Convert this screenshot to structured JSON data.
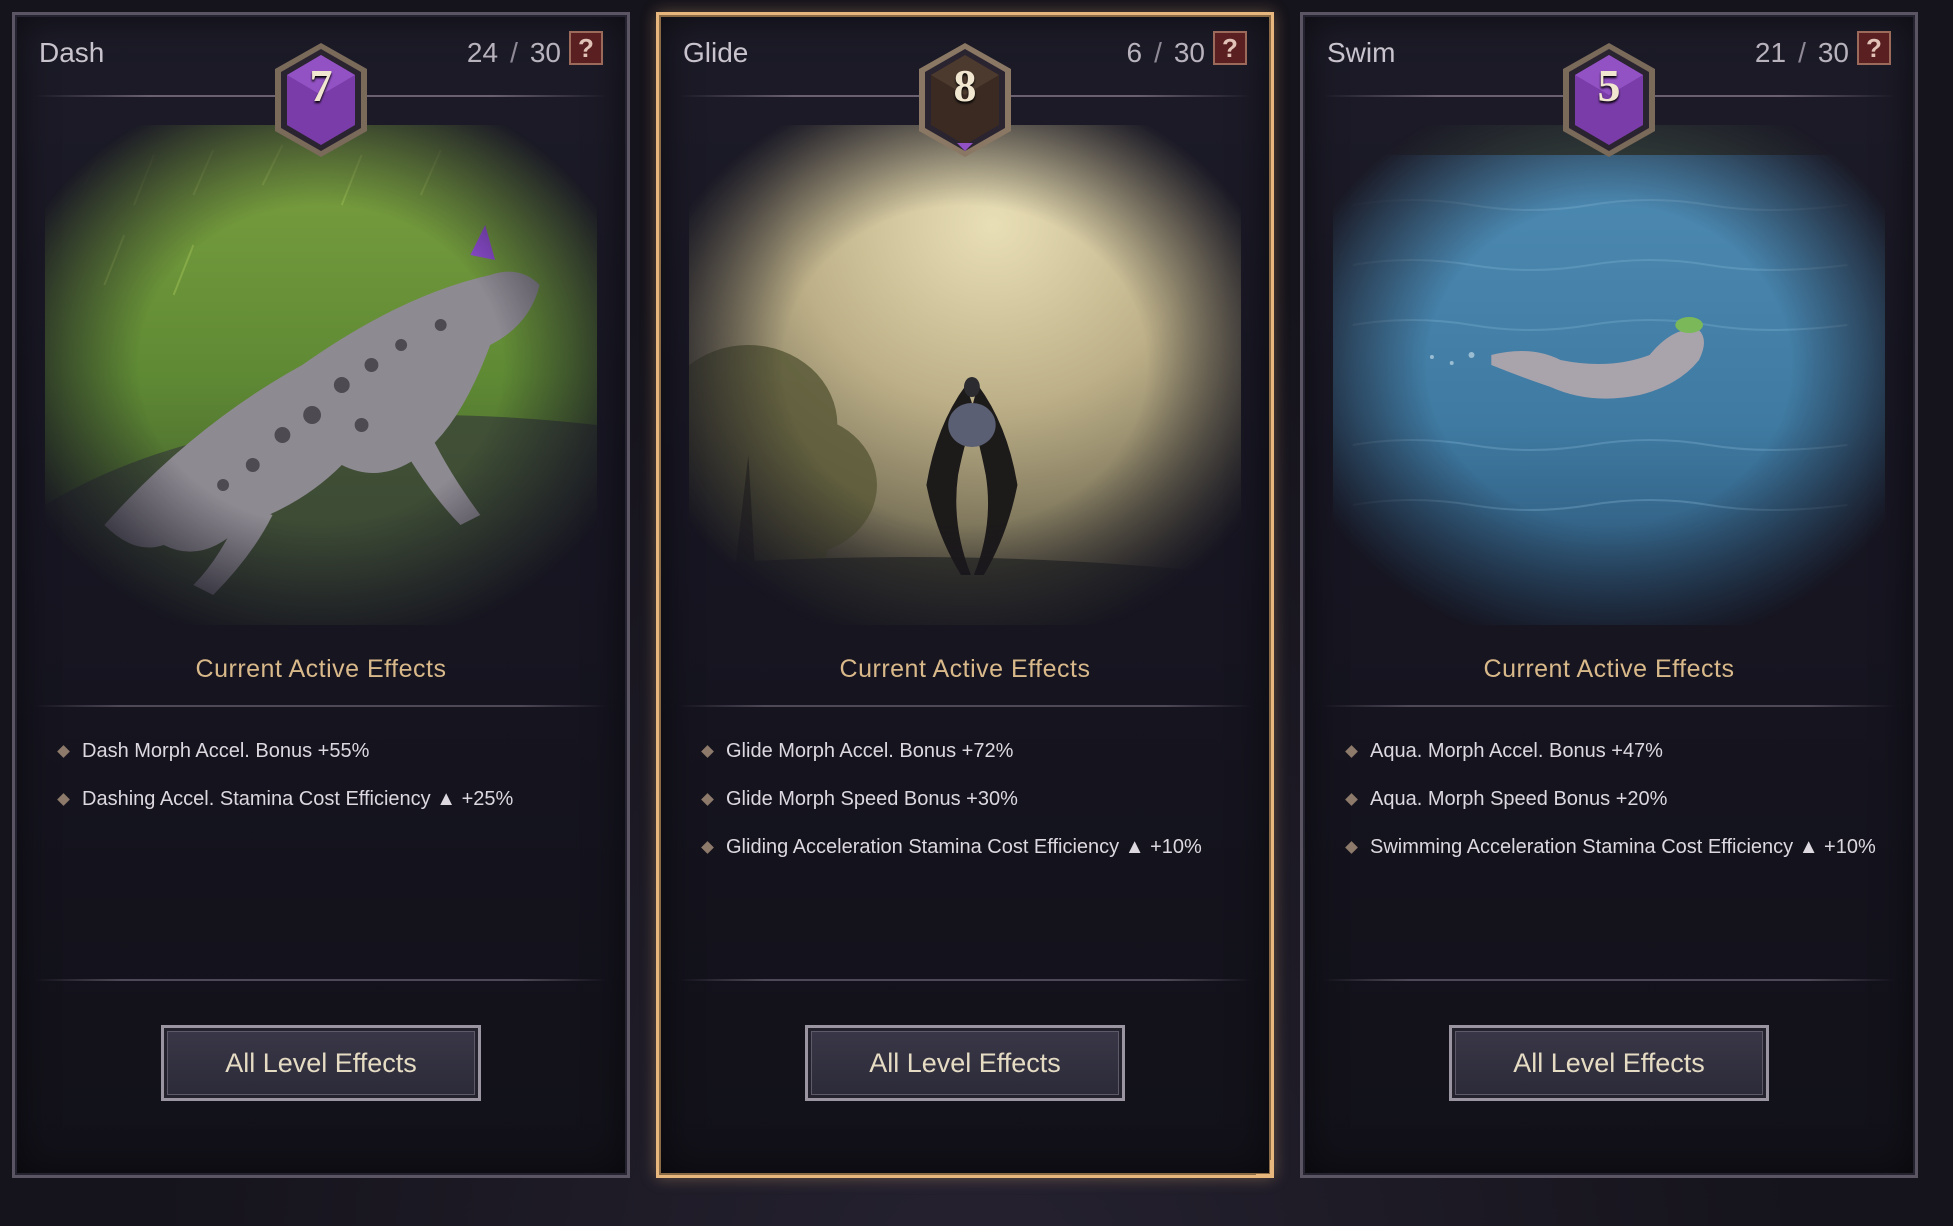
{
  "cards": [
    {
      "title": "Dash",
      "level": "7",
      "current": "24",
      "separator": "/",
      "max": "30",
      "help_label": "?",
      "badge_color": "#7a3ca8",
      "selected": false,
      "effects_title": "Current Active Effects",
      "effects": [
        "Dash Morph Accel. Bonus +55%",
        "Dashing Accel. Stamina Cost Efficiency ▲ +25%"
      ],
      "button_label": "All Level Effects"
    },
    {
      "title": "Glide",
      "level": "8",
      "current": "6",
      "separator": "/",
      "max": "30",
      "help_label": "?",
      "badge_color": "#3a2a22",
      "selected": true,
      "effects_title": "Current Active Effects",
      "effects": [
        "Glide Morph Accel. Bonus +72%",
        "Glide Morph Speed Bonus  +30%",
        "Gliding Acceleration Stamina Cost Efficiency ▲ +10%"
      ],
      "button_label": "All Level Effects"
    },
    {
      "title": "Swim",
      "level": "5",
      "current": "21",
      "separator": "/",
      "max": "30",
      "help_label": "?",
      "badge_color": "#7a3ca8",
      "selected": false,
      "effects_title": "Current Active Effects",
      "effects": [
        "Aqua. Morph Accel. Bonus +47%",
        "Aqua. Morph Speed Bonus +20%",
        "Swimming Acceleration Stamina Cost Efficiency ▲ +10%"
      ],
      "button_label": "All Level Effects"
    }
  ],
  "colors": {
    "selected_border": "#e7b77e",
    "effects_heading": "#d9b98a",
    "badge_purple": "#7a3ca8"
  }
}
